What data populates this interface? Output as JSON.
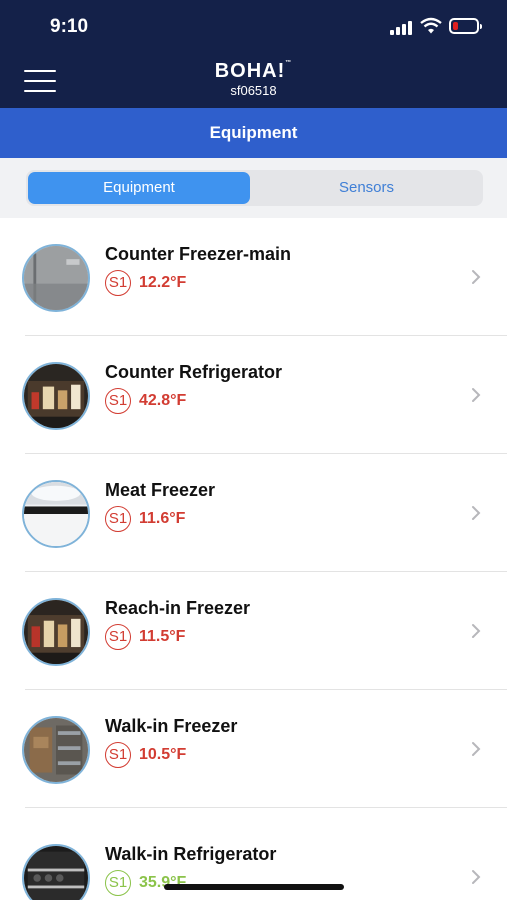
{
  "status_bar": {
    "time": "9:10"
  },
  "header": {
    "logo": "BOHA!",
    "logo_tm": "™",
    "site_id": "sf06518"
  },
  "title_bar": {
    "title": "Equipment"
  },
  "segments": {
    "active": "Equipment",
    "inactive": "Sensors"
  },
  "colors": {
    "alert": "#d23c32",
    "ok": "#8bc34a",
    "nav": "#142149",
    "accent": "#2f5fcc"
  },
  "equipment": [
    {
      "name": "Counter Freezer-main",
      "sensor": "S1",
      "temp": "12.2°F",
      "status": "alert"
    },
    {
      "name": "Counter Refrigerator",
      "sensor": "S1",
      "temp": "42.8°F",
      "status": "alert"
    },
    {
      "name": "Meat Freezer",
      "sensor": "S1",
      "temp": "11.6°F",
      "status": "alert"
    },
    {
      "name": "Reach-in Freezer",
      "sensor": "S1",
      "temp": "11.5°F",
      "status": "alert"
    },
    {
      "name": "Walk-in Freezer",
      "sensor": "S1",
      "temp": "10.5°F",
      "status": "alert"
    },
    {
      "name": "Walk-in Refrigerator",
      "sensor": "S1",
      "temp": "35.9°F",
      "status": "ok"
    }
  ]
}
